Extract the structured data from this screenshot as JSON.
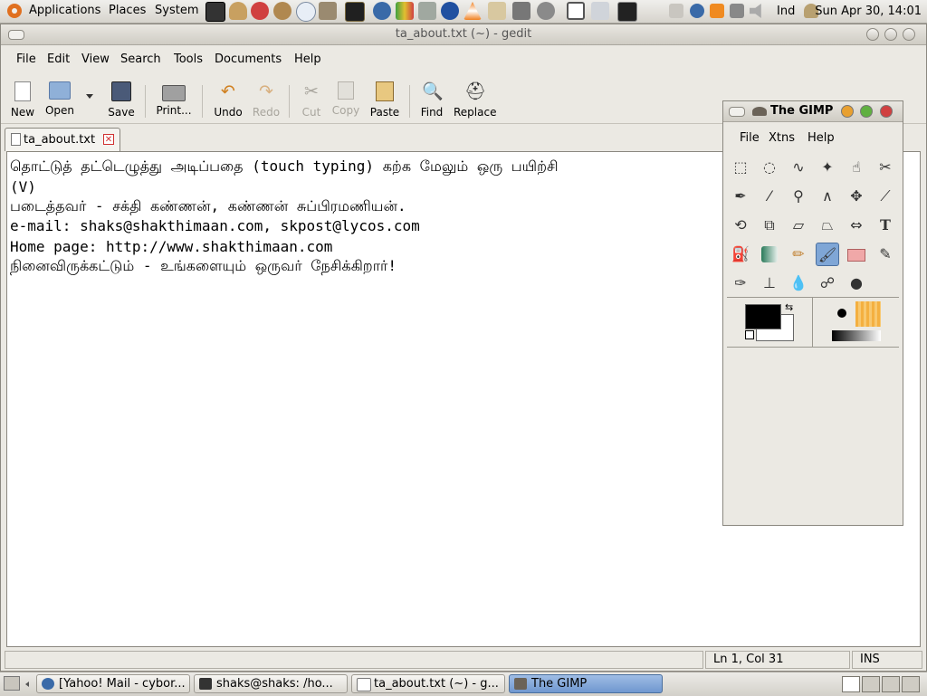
{
  "top_panel": {
    "menus": [
      "Applications",
      "Places",
      "System"
    ],
    "keyboard_layout": "Ind",
    "clock": "Sun Apr 30, 14:01"
  },
  "gedit": {
    "title": "ta_about.txt (~) - gedit",
    "menu": [
      "File",
      "Edit",
      "View",
      "Search",
      "Tools",
      "Documents",
      "Help"
    ],
    "toolbar": {
      "new": "New",
      "open": "Open",
      "save": "Save",
      "print": "Print...",
      "undo": "Undo",
      "redo": "Redo",
      "cut": "Cut",
      "copy": "Copy",
      "paste": "Paste",
      "find": "Find",
      "replace": "Replace"
    },
    "tab": {
      "label": "ta_about.txt"
    },
    "document_lines": [
      "தொட்டுத் தட்டெழுத்து அடிப்பதை (touch typing) கற்க மேலும் ஒரு பயிற்சி",
      "(V)",
      "படைத்தவர் - சக்தி கண்ணன், கண்ணன் சுப்பிரமணியன்.",
      "e-mail: shaks@shakthimaan.com, skpost@lycos.com",
      "Home page: http://www.shakthimaan.com",
      "நினைவிருக்கட்டும் - உங்களையும் ஒருவர் நேசிக்கிறார்!"
    ],
    "status": {
      "position": "Ln 1, Col 31",
      "mode": "INS"
    }
  },
  "gimp": {
    "title": "The GIMP",
    "menu": [
      "File",
      "Xtns",
      "Help"
    ]
  },
  "taskbar": {
    "tasks": [
      {
        "label": "[Yahoo! Mail - cybor..."
      },
      {
        "label": "shaks@shaks: /ho..."
      },
      {
        "label": "ta_about.txt (~) - g..."
      },
      {
        "label": "The GIMP"
      }
    ]
  },
  "colors": {
    "accent": "#7fa6d6",
    "ubuntu_orange": "#e07020"
  }
}
